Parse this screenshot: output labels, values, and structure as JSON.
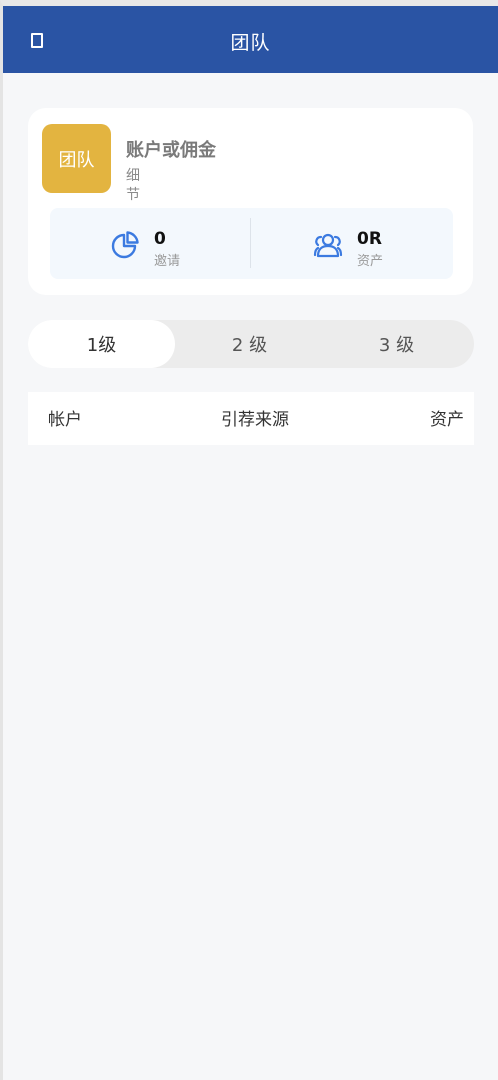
{
  "header": {
    "title": "团队"
  },
  "summary": {
    "badge_text": "团队",
    "title": "账户或佣金",
    "detail_link": "细节",
    "invites": {
      "value": "0",
      "label": "邀请",
      "icon": "pie-chart-icon"
    },
    "assets": {
      "value": "0R",
      "label": "资产",
      "icon": "users-icon"
    }
  },
  "tabs": [
    {
      "label": "1级",
      "active": true
    },
    {
      "label": "2 级",
      "active": false
    },
    {
      "label": "3 级",
      "active": false
    }
  ],
  "table": {
    "columns": [
      "帐户",
      "引荐来源",
      "资产"
    ]
  },
  "colors": {
    "header_bg": "#2a54a4",
    "badge_bg": "#e3b440",
    "icon_blue": "#3b7ae0"
  }
}
